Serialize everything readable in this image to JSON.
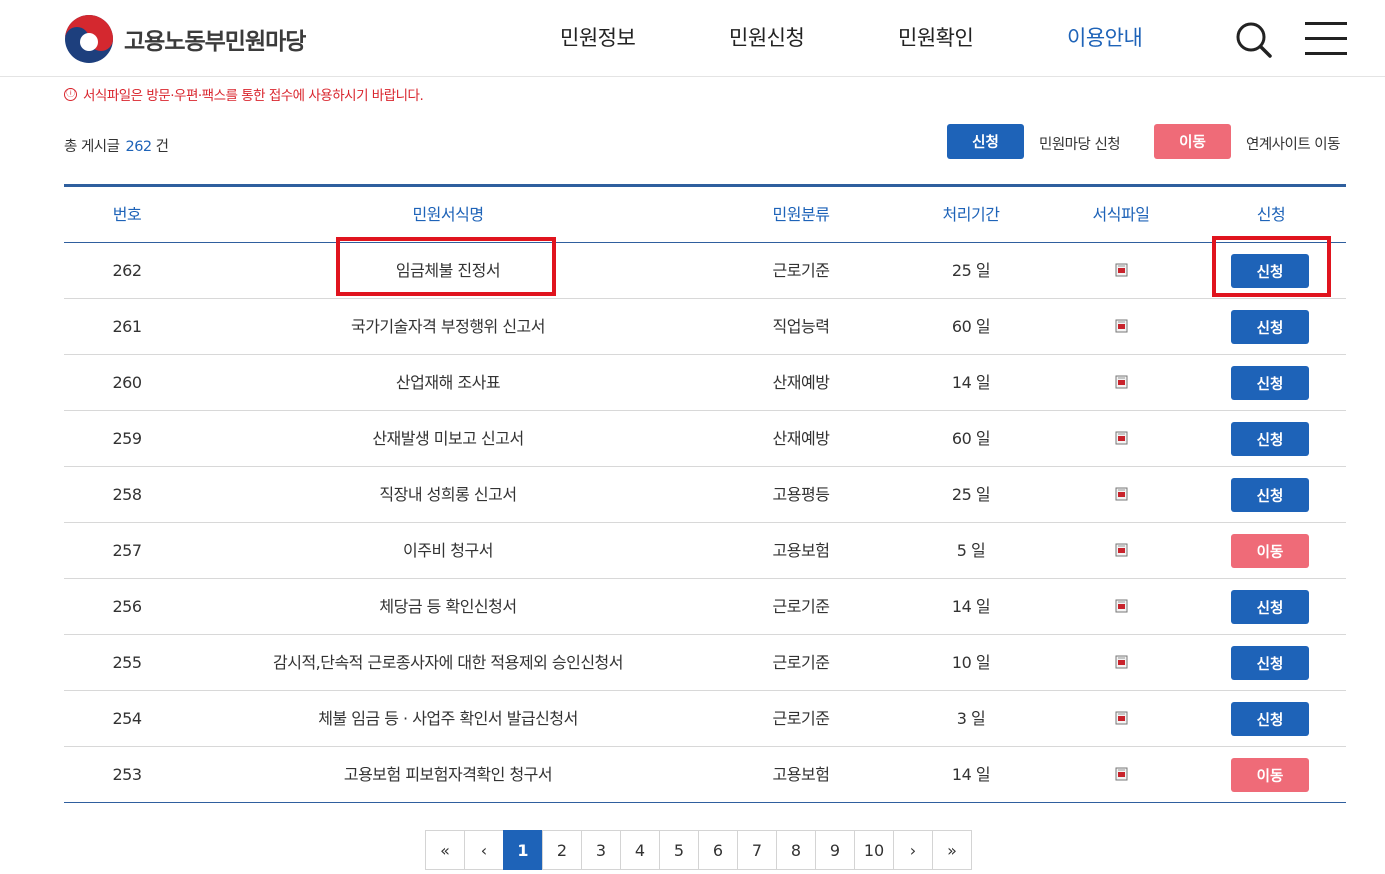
{
  "header": {
    "logo_text": "고용노동부민원마당",
    "nav": [
      "민원정보",
      "민원신청",
      "민원확인",
      "이용안내"
    ],
    "active_nav": "이용안내",
    "colors": {
      "accent": "#1e63b8",
      "danger": "#ef6b78",
      "highlight": "#e0141e",
      "notice": "#d9262e"
    }
  },
  "notice": {
    "icon": "ⓘ",
    "text": "서식파일은 방문·우편·팩스를 통한 접수에 사용하시기 바랍니다."
  },
  "summary": {
    "label": "총 게시글",
    "count": "262",
    "unit": "건"
  },
  "legend": {
    "apply_button": "신청",
    "apply_desc": "민원마당 신청",
    "move_button": "이동",
    "move_desc": "연계사이트 이동"
  },
  "table": {
    "headers": [
      "번호",
      "민원서식명",
      "민원분류",
      "처리기간",
      "서식파일",
      "신청"
    ],
    "rows": [
      {
        "no": "262",
        "name": "임금체불 진정서",
        "category": "근로기준",
        "days": "25 일",
        "action": "신청",
        "type": "blue"
      },
      {
        "no": "261",
        "name": "국가기술자격 부정행위 신고서",
        "category": "직업능력",
        "days": "60 일",
        "action": "신청",
        "type": "blue"
      },
      {
        "no": "260",
        "name": "산업재해 조사표",
        "category": "산재예방",
        "days": "14 일",
        "action": "신청",
        "type": "blue"
      },
      {
        "no": "259",
        "name": "산재발생 미보고 신고서",
        "category": "산재예방",
        "days": "60 일",
        "action": "신청",
        "type": "blue"
      },
      {
        "no": "258",
        "name": "직장내 성희롱 신고서",
        "category": "고용평등",
        "days": "25 일",
        "action": "신청",
        "type": "blue"
      },
      {
        "no": "257",
        "name": "이주비 청구서",
        "category": "고용보험",
        "days": "5 일",
        "action": "이동",
        "type": "red"
      },
      {
        "no": "256",
        "name": "체당금 등 확인신청서",
        "category": "근로기준",
        "days": "14 일",
        "action": "신청",
        "type": "blue"
      },
      {
        "no": "255",
        "name": "감시적,단속적 근로종사자에 대한 적용제외 승인신청서",
        "category": "근로기준",
        "days": "10 일",
        "action": "신청",
        "type": "blue"
      },
      {
        "no": "254",
        "name": "체불 임금 등 · 사업주 확인서 발급신청서",
        "category": "근로기준",
        "days": "3 일",
        "action": "신청",
        "type": "blue"
      },
      {
        "no": "253",
        "name": "고용보험 피보험자격확인 청구서",
        "category": "고용보험",
        "days": "14 일",
        "action": "이동",
        "type": "red"
      }
    ]
  },
  "pagination": {
    "first": "«",
    "prev": "‹",
    "pages": [
      "1",
      "2",
      "3",
      "4",
      "5",
      "6",
      "7",
      "8",
      "9",
      "10"
    ],
    "current": "1",
    "next": "›",
    "last": "»"
  }
}
